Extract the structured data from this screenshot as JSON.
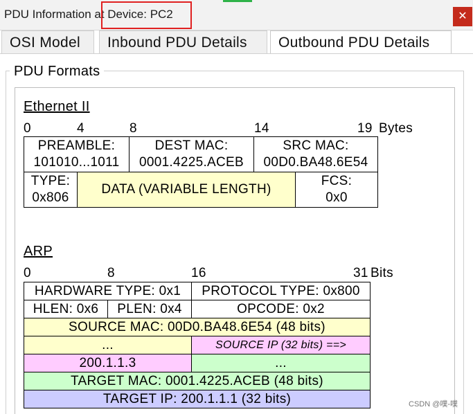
{
  "window": {
    "title": "PDU Information at Device: PC2",
    "close_glyph": "✕"
  },
  "tabs": [
    {
      "label": "OSI Model",
      "active": false
    },
    {
      "label": "Inbound PDU Details",
      "active": false
    },
    {
      "label": "Outbound PDU Details",
      "active": true
    }
  ],
  "group_label": "PDU Formats",
  "ethernet": {
    "title": "Ethernet II",
    "ruler": [
      "0",
      "4",
      "8",
      "14",
      "19",
      "Bytes"
    ],
    "preamble": {
      "label": "PREAMBLE:",
      "value": "101010...1011"
    },
    "dest_mac": {
      "label": "DEST MAC:",
      "value": "0001.4225.ACEB"
    },
    "src_mac": {
      "label": "SRC MAC:",
      "value": "00D0.BA48.6E54"
    },
    "type": {
      "label": "TYPE:",
      "value": "0x806"
    },
    "data": "DATA (VARIABLE LENGTH)",
    "fcs": {
      "label": "FCS:",
      "value": "0x0"
    }
  },
  "arp": {
    "title": "ARP",
    "ruler": [
      "0",
      "8",
      "16",
      "31",
      "Bits"
    ],
    "hardware_type": "HARDWARE TYPE: 0x1",
    "protocol_type": "PROTOCOL TYPE: 0x800",
    "hlen": "HLEN: 0x6",
    "plen": "PLEN: 0x4",
    "opcode": "OPCODE: 0x2",
    "source_mac": "SOURCE MAC: 00D0.BA48.6E54 (48 bits)",
    "source_mac_cont": "...",
    "source_ip_label": "SOURCE IP (32 bits) ==>",
    "source_ip_value": "200.1.1.3",
    "target_mac_cont": "...",
    "target_mac": "TARGET MAC: 0001.4225.ACEB (48 bits)",
    "target_ip": "TARGET IP: 200.1.1.1 (32 bits)"
  },
  "watermark": "CSDN @噗-噗",
  "colors": {
    "yellow": "#ffffcc",
    "pink": "#ffccff",
    "green": "#ccffcc",
    "blue": "#ccccff",
    "close": "#c42b1c",
    "highlight": "#e02020"
  }
}
